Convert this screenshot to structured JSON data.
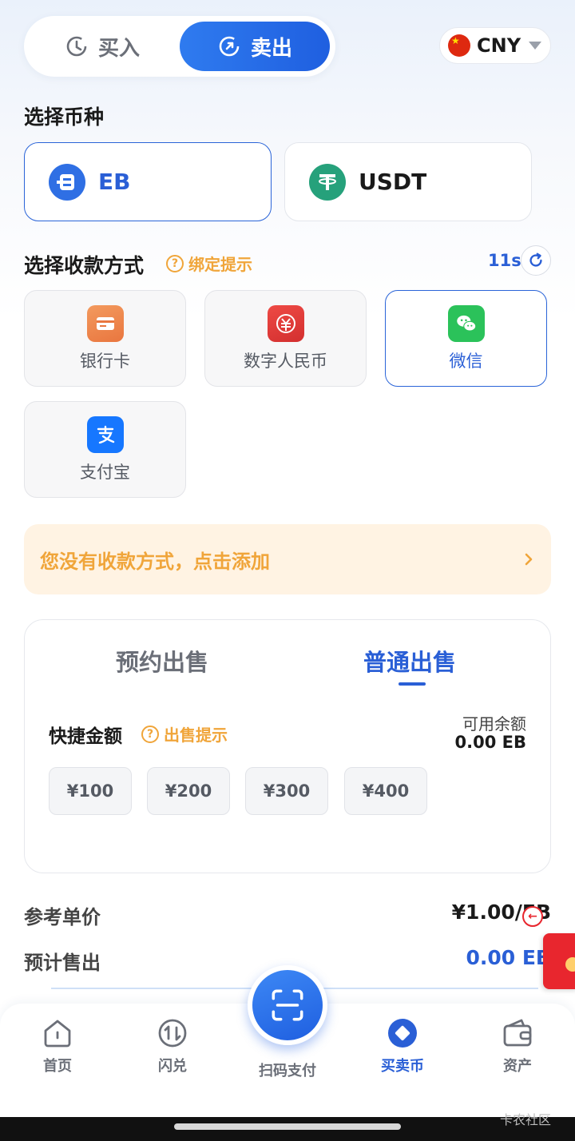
{
  "mode_toggle": {
    "buy_label": "买入",
    "sell_label": "卖出",
    "active": "sell"
  },
  "currency_selector": {
    "value": "CNY"
  },
  "coin_section": {
    "title": "选择币种",
    "coins": [
      {
        "label": "EB",
        "selected": true
      },
      {
        "label": "USDT",
        "selected": false
      }
    ]
  },
  "payment_section": {
    "title": "选择收款方式",
    "hint": "绑定提示",
    "countdown": "11s",
    "methods": [
      {
        "label": "银行卡",
        "icon": "bank-card-icon",
        "selected": false
      },
      {
        "label": "数字人民币",
        "icon": "digital-rmb-icon",
        "selected": false
      },
      {
        "label": "微信",
        "icon": "wechat-icon",
        "selected": true
      },
      {
        "label": "支付宝",
        "icon": "alipay-icon",
        "selected": false
      }
    ]
  },
  "notice": {
    "text": "您没有收款方式，点击添加"
  },
  "sell_panel": {
    "tabs": [
      {
        "label": "预约出售",
        "active": false
      },
      {
        "label": "普通出售",
        "active": true
      }
    ],
    "quick_amount_title": "快捷金额",
    "sell_hint": "出售提示",
    "balance_label": "可用余额",
    "balance_value": "0.00 EB",
    "amounts": [
      "¥100",
      "¥200",
      "¥300",
      "¥400"
    ]
  },
  "summary": {
    "ref_price_label": "参考单价",
    "ref_price_value": "¥1.00/EB",
    "est_sell_label": "预计售出",
    "est_sell_value": "0.00 EB"
  },
  "bottom_nav": {
    "items": [
      {
        "label": "首页"
      },
      {
        "label": "闪兑"
      },
      {
        "label": "扫码支付"
      },
      {
        "label": "买卖币",
        "active": true
      },
      {
        "label": "资产"
      }
    ]
  },
  "watermark": "卡农社区",
  "colors": {
    "accent": "#2a5fd6",
    "warning": "#f0a53a",
    "notice_bg": "#fff3e3",
    "usdt": "#26a17b",
    "wechat": "#2bc25a",
    "alipay": "#1677ff"
  }
}
